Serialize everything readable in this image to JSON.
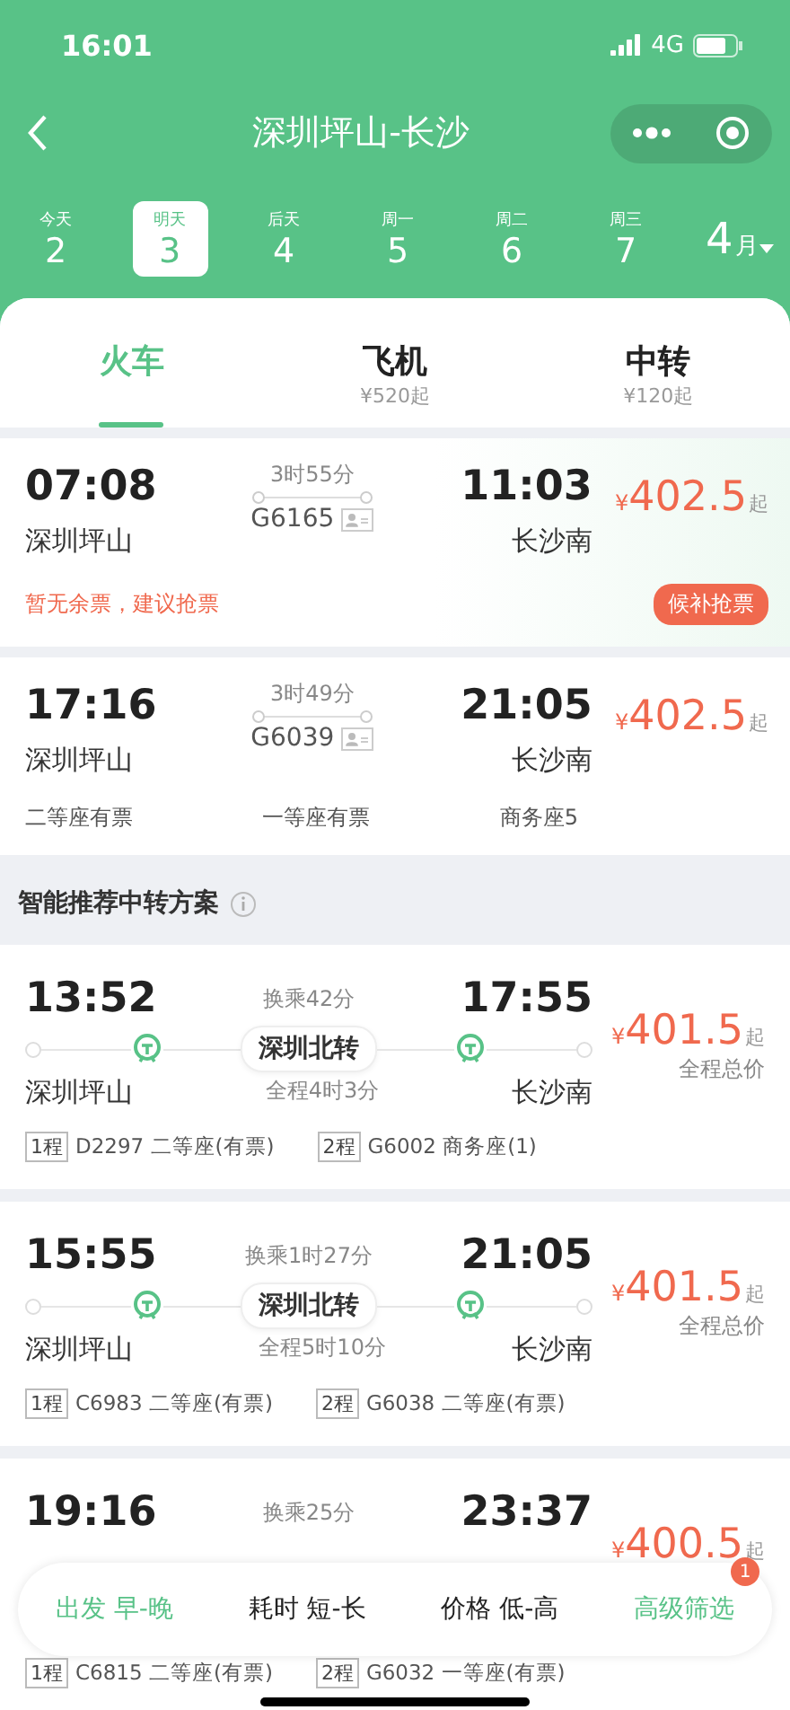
{
  "status_bar": {
    "time": "16:01",
    "network": "4G"
  },
  "nav": {
    "title": "深圳坪山-长沙"
  },
  "dates": [
    {
      "weekday": "今天",
      "day": "2",
      "selected": false
    },
    {
      "weekday": "明天",
      "day": "3",
      "selected": true
    },
    {
      "weekday": "后天",
      "day": "4",
      "selected": false
    },
    {
      "weekday": "周一",
      "day": "5",
      "selected": false
    },
    {
      "weekday": "周二",
      "day": "6",
      "selected": false
    },
    {
      "weekday": "周三",
      "day": "7",
      "selected": false
    }
  ],
  "month": {
    "number": "4",
    "unit": "月"
  },
  "tabs": [
    {
      "label": "火车",
      "selected": true
    },
    {
      "label": "飞机",
      "sub": "¥520起",
      "selected": false
    },
    {
      "label": "中转",
      "sub": "¥120起",
      "selected": false
    }
  ],
  "trains": [
    {
      "depart_time": "07:08",
      "depart_station": "深圳坪山",
      "duration": "3时55分",
      "train_no": "G6165",
      "arrive_time": "11:03",
      "arrive_station": "长沙南",
      "currency": "¥",
      "price": "402.5",
      "price_suffix": "起",
      "notice": "暂无余票，建议抢票",
      "action": "候补抢票"
    },
    {
      "depart_time": "17:16",
      "depart_station": "深圳坪山",
      "duration": "3时49分",
      "train_no": "G6039",
      "arrive_time": "21:05",
      "arrive_station": "长沙南",
      "currency": "¥",
      "price": "402.5",
      "price_suffix": "起",
      "seats": [
        "二等座有票",
        "一等座有票",
        "商务座5"
      ]
    }
  ],
  "section_title": "智能推荐中转方案",
  "transfers": [
    {
      "depart_time": "13:52",
      "wait": "换乘42分",
      "arrive_time": "17:55",
      "via": "深圳北转",
      "depart_station": "深圳坪山",
      "total_time": "全程4时3分",
      "arrive_station": "长沙南",
      "currency": "¥",
      "price": "401.5",
      "price_suffix": "起",
      "price_note": "全程总价",
      "legs": [
        {
          "tag": "1程",
          "text": "D2297 二等座(有票)"
        },
        {
          "tag": "2程",
          "text": "G6002 商务座(1)"
        }
      ]
    },
    {
      "depart_time": "15:55",
      "wait": "换乘1时27分",
      "arrive_time": "21:05",
      "via": "深圳北转",
      "depart_station": "深圳坪山",
      "total_time": "全程5时10分",
      "arrive_station": "长沙南",
      "currency": "¥",
      "price": "401.5",
      "price_suffix": "起",
      "price_note": "全程总价",
      "legs": [
        {
          "tag": "1程",
          "text": "C6983 二等座(有票)"
        },
        {
          "tag": "2程",
          "text": "G6038 二等座(有票)"
        }
      ]
    },
    {
      "depart_time": "19:16",
      "wait": "换乘25分",
      "arrive_time": "23:37",
      "currency": "¥",
      "price": "400.5",
      "price_suffix": "起",
      "legs": [
        {
          "tag": "1程",
          "text": "C6815 二等座(有票)"
        },
        {
          "tag": "2程",
          "text": "G6032 一等座(有票)"
        }
      ]
    }
  ],
  "filter_bar": [
    {
      "label": "出发 早-晚",
      "selected": true
    },
    {
      "label": "耗时 短-长",
      "selected": false
    },
    {
      "label": "价格 低-高",
      "selected": false
    },
    {
      "label": "高级筛选",
      "selected": true,
      "badge": "1"
    }
  ]
}
